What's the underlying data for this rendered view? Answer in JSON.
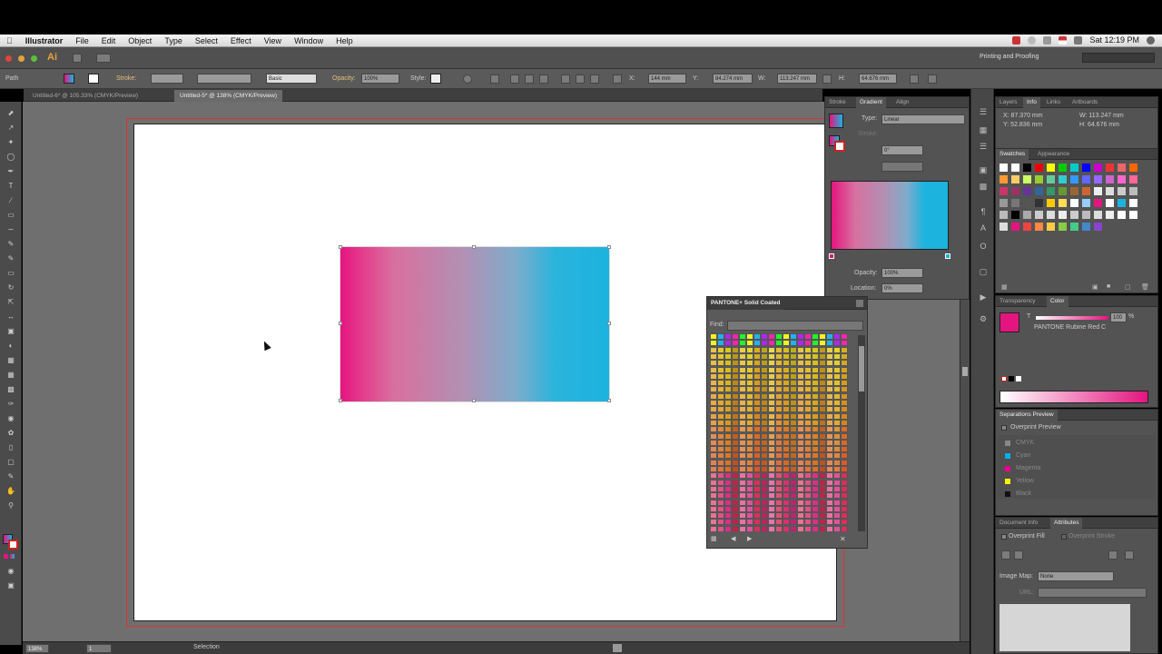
{
  "menubar": {
    "app": "Illustrator",
    "items": [
      "File",
      "Edit",
      "Object",
      "Type",
      "Select",
      "Effect",
      "View",
      "Window",
      "Help"
    ],
    "clock": "Sat 12:19 PM"
  },
  "workspace": {
    "label": "Printing and Proofing"
  },
  "control": {
    "mode": "Path",
    "stroke_label": "Stroke:",
    "stroke_style": "Basic",
    "opacity_label": "Opacity:",
    "opacity_value": "100%",
    "style_label": "Style:",
    "x_label": "X:",
    "x_value": "144 mm",
    "y_label": "Y:",
    "y_value": "84.274 mm",
    "w_label": "W:",
    "w_value": "113.247 mm",
    "h_label": "H:",
    "h_value": "64.676 mm"
  },
  "tabs": [
    {
      "label": "Untitled-6* @ 105.33% (CMYK/Preview)"
    },
    {
      "label": "Untitled-5* @ 138% (CMYK/Preview)"
    }
  ],
  "gradient_panel": {
    "tabs": [
      "Stroke",
      "Gradient",
      "Align"
    ],
    "type_label": "Type:",
    "type_value": "Linear",
    "stroke_label": "Stroke:",
    "angle_value": "0°",
    "opacity_label": "Opacity:",
    "opacity_value": "100%",
    "location_label": "Location:",
    "location_value": "0%",
    "start_color": "#e4157f",
    "end_color": "#1cb3df"
  },
  "pantone_panel": {
    "title": "PANTONE+ Solid Coated",
    "find_label": "Find:"
  },
  "info_panel": {
    "tabs": [
      "Layers",
      "Info",
      "Links",
      "Artboards"
    ],
    "x": "X: 87.370 mm",
    "y": "Y: 52.836 mm",
    "w": "W: 113.247 mm",
    "h": "H: 64.676 mm"
  },
  "swatches_panel": {
    "tabs": [
      "Swatches",
      "Appearance"
    ]
  },
  "color_panel": {
    "tabs": [
      "Transparency",
      "Color"
    ],
    "tint_label": "T",
    "tint_value": "100",
    "pantone_name": "PANTONE Rubine Red C",
    "percent": "%",
    "color": "#e4157f"
  },
  "separations_panel": {
    "title": "Separations Preview",
    "overprint": "Overprint Preview",
    "inks": [
      {
        "name": "CMYK",
        "color": "#888888"
      },
      {
        "name": "Cyan",
        "color": "#00aeef"
      },
      {
        "name": "Magenta",
        "color": "#ec008c"
      },
      {
        "name": "Yellow",
        "color": "#fff200"
      },
      {
        "name": "Black",
        "color": "#111111"
      }
    ]
  },
  "attributes_panel": {
    "tabs": [
      "Document Info",
      "Attributes"
    ],
    "overprint_fill": "Overprint Fill",
    "overprint_stroke": "Overprint Stroke",
    "imagemap_label": "Image Map:",
    "imagemap_value": "None",
    "url_label": "URL:"
  },
  "status": {
    "zoom": "138%",
    "page": "1",
    "tool": "Selection"
  }
}
